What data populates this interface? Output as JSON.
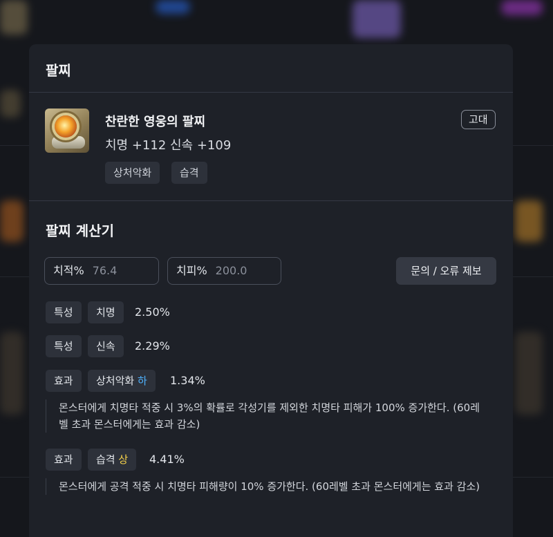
{
  "colors": {
    "page_bg": "#15171c",
    "modal_bg": "#1e2128",
    "chip_bg": "#2d313a",
    "grade_low": "#4fb3ff",
    "grade_high": "#f6d24a"
  },
  "modal": {
    "title": "팔찌",
    "item": {
      "icon": "bracelet-item-icon",
      "name": "찬란한 영웅의 팔찌",
      "stats": "치명 +112  신속 +109",
      "grade": "고대",
      "tags": [
        "상처악화",
        "습격"
      ]
    },
    "calculator": {
      "title": "팔찌 계산기",
      "crit_rate": {
        "label": "치적%",
        "placeholder": "76.4"
      },
      "crit_damage": {
        "label": "치피%",
        "placeholder": "200.0"
      },
      "report_button": "문의 / 오류 제보",
      "rows": [
        {
          "type": "특성",
          "name": "치명",
          "value": "2.50%"
        },
        {
          "type": "특성",
          "name": "신속",
          "value": "2.29%"
        },
        {
          "type": "효과",
          "name": "상처악화",
          "grade": "하",
          "value": "1.34%",
          "description": "몬스터에게 치명타 적중 시 3%의 확률로 각성기를 제외한 치명타 피해가 100% 증가한다. (60레벨 초과 몬스터에게는 효과 감소)"
        },
        {
          "type": "효과",
          "name": "습격",
          "grade": "상",
          "value": "4.41%",
          "description": "몬스터에게 공격 적중 시 치명타 피해량이 10% 증가한다. (60레벨 초과 몬스터에게는 효과 감소)"
        }
      ]
    }
  }
}
